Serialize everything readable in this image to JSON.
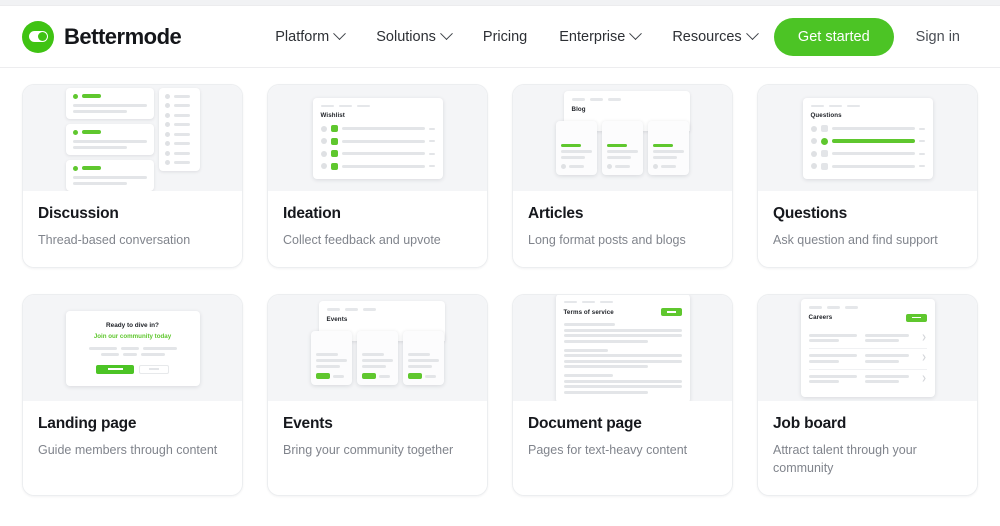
{
  "header": {
    "brand": "Bettermode",
    "logo_color": "#3fc313",
    "nav": [
      {
        "label": "Platform",
        "has_dropdown": true
      },
      {
        "label": "Solutions",
        "has_dropdown": true
      },
      {
        "label": "Pricing",
        "has_dropdown": false
      },
      {
        "label": "Enterprise",
        "has_dropdown": true
      },
      {
        "label": "Resources",
        "has_dropdown": true
      }
    ],
    "cta_label": "Get started",
    "cta_color": "#4cc425",
    "signin_label": "Sign in"
  },
  "cards": [
    {
      "title": "Discussion",
      "subtitle": "Thread-based conversation",
      "thumb": "discussion",
      "thumb_title": ""
    },
    {
      "title": "Ideation",
      "subtitle": "Collect feedback and upvote",
      "thumb": "list-panel",
      "thumb_title": "Wishlist"
    },
    {
      "title": "Articles",
      "subtitle": "Long format posts and blogs",
      "thumb": "stack",
      "thumb_title": "Blog"
    },
    {
      "title": "Questions",
      "subtitle": "Ask question and find support",
      "thumb": "list-panel",
      "thumb_title": "Questions"
    },
    {
      "title": "Landing page",
      "subtitle": "Guide members through content",
      "thumb": "landing",
      "thumb_title": "",
      "landing_heading": "Ready to dive in?",
      "landing_sub": "Join our community today"
    },
    {
      "title": "Events",
      "subtitle": "Bring your community together",
      "thumb": "stack",
      "thumb_title": "Events"
    },
    {
      "title": "Document page",
      "subtitle": "Pages for text-heavy content",
      "thumb": "document",
      "thumb_title": "Terms of service"
    },
    {
      "title": "Job board",
      "subtitle": "Attract talent through your community",
      "thumb": "jobboard",
      "thumb_title": "Careers"
    }
  ]
}
